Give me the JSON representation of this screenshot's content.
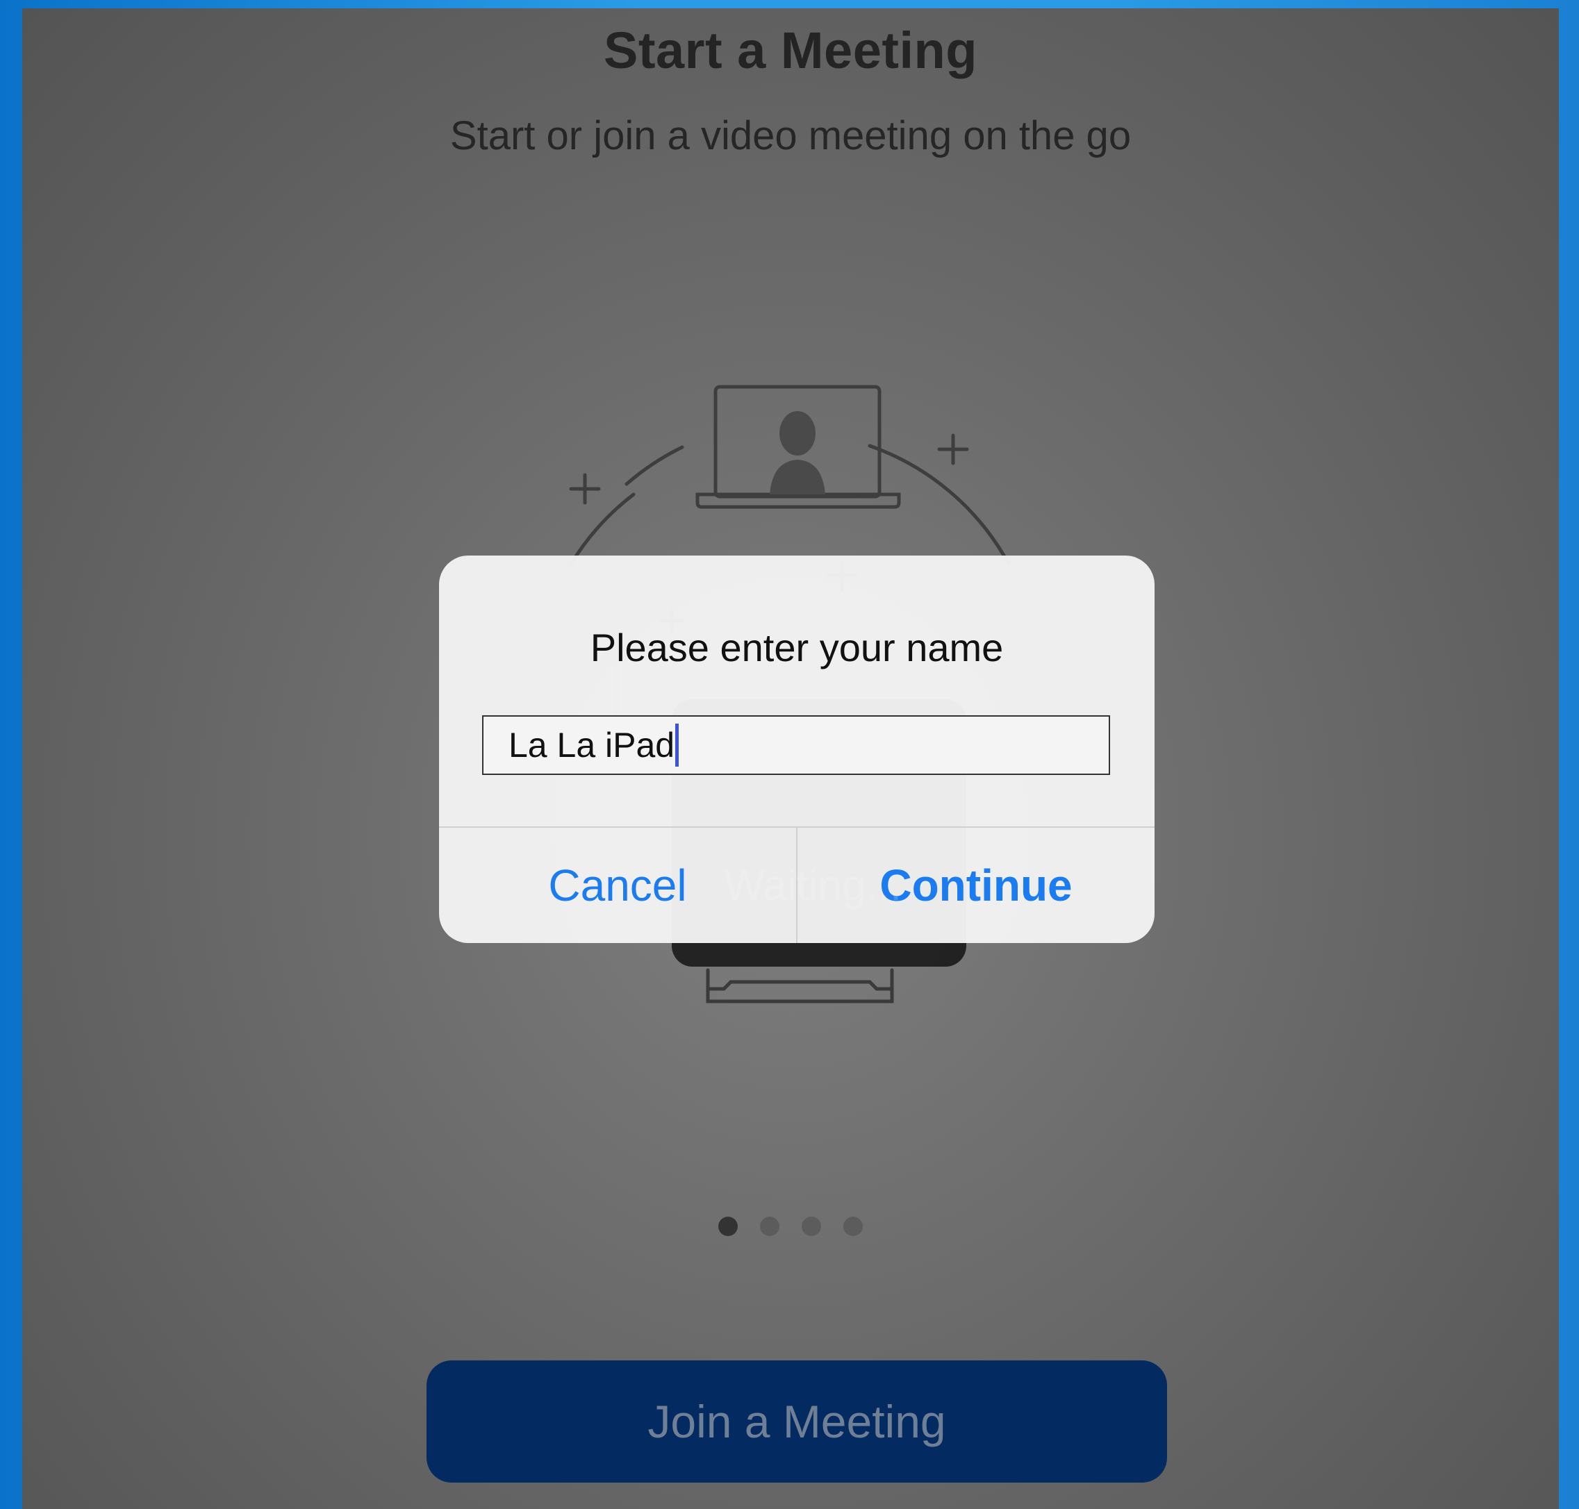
{
  "screen": {
    "title": "Start a Meeting",
    "subtitle": "Start or join a video meeting on the go",
    "page_indicator": {
      "count": 4,
      "active": 0
    },
    "join_button_label": "Join a Meeting",
    "waiting_text": "Waiting..."
  },
  "alert": {
    "title": "Please enter your name",
    "input_value": "La La iPad",
    "cancel_label": "Cancel",
    "continue_label": "Continue"
  },
  "colors": {
    "accent": "#1a7cf0",
    "join_button_bg": "#032b62",
    "background_frame": "#2a9be6"
  }
}
